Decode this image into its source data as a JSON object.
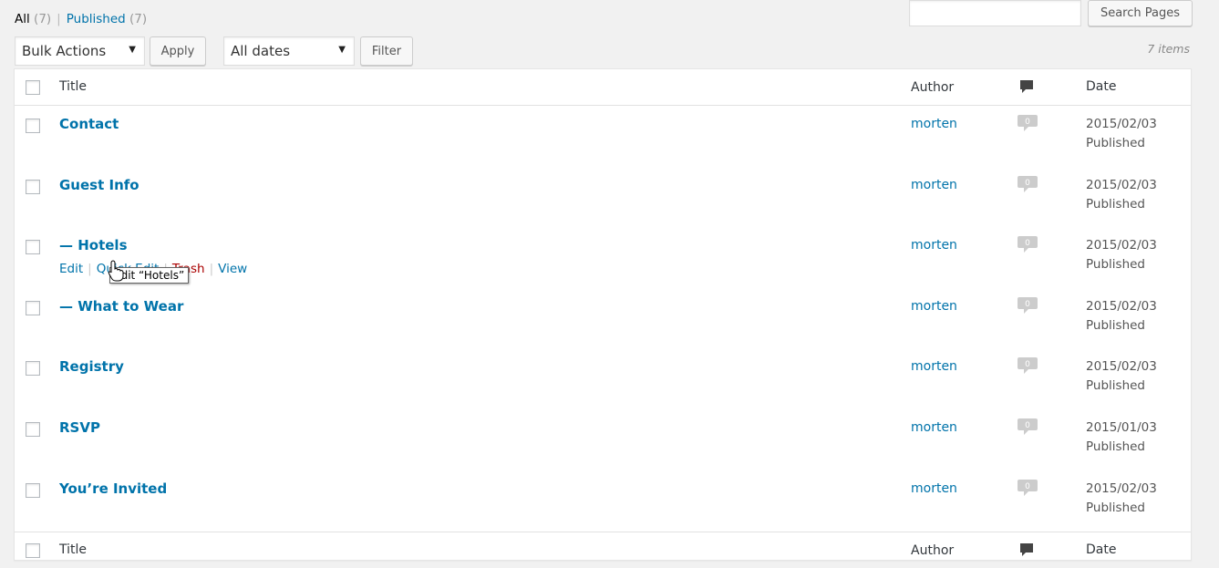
{
  "views": {
    "all_label": "All",
    "all_count": "(7)",
    "separator": "|",
    "published_label": "Published",
    "published_count": "(7)"
  },
  "search": {
    "value": "",
    "button_label": "Search Pages"
  },
  "bulk_actions": {
    "selected": "Bulk Actions",
    "apply_label": "Apply"
  },
  "date_filter": {
    "selected": "All dates",
    "filter_label": "Filter"
  },
  "items_count": "7 items",
  "table": {
    "columns": {
      "title": "Title",
      "author": "Author",
      "date": "Date"
    },
    "rows": [
      {
        "title": "Contact",
        "author": "morten",
        "comments": "0",
        "date": "2015/02/03",
        "status": "Published"
      },
      {
        "title": "Guest Info",
        "author": "morten",
        "comments": "0",
        "date": "2015/02/03",
        "status": "Published"
      },
      {
        "title": "— Hotels",
        "author": "morten",
        "comments": "0",
        "date": "2015/02/03",
        "status": "Published"
      },
      {
        "title": "— What to Wear",
        "author": "morten",
        "comments": "0",
        "date": "2015/02/03",
        "status": "Published"
      },
      {
        "title": "Registry",
        "author": "morten",
        "comments": "0",
        "date": "2015/02/03",
        "status": "Published"
      },
      {
        "title": "RSVP",
        "author": "morten",
        "comments": "0",
        "date": "2015/01/03",
        "status": "Published"
      },
      {
        "title": "You’re Invited",
        "author": "morten",
        "comments": "0",
        "date": "2015/02/03",
        "status": "Published"
      }
    ],
    "row_actions": {
      "edit": "Edit",
      "quick_edit": "Quick Edit",
      "trash": "Trash",
      "view": "View",
      "separator": "|"
    },
    "tooltip": "Edit “Hotels”"
  },
  "colors": {
    "link": "#0073aa",
    "trash": "#a00000",
    "background": "#f1f1f1"
  },
  "icons": {
    "comments_header": "comment-bubble-icon",
    "comment_count": "comment-count-bubble-icon",
    "cursor": "hand-pointer-icon"
  }
}
